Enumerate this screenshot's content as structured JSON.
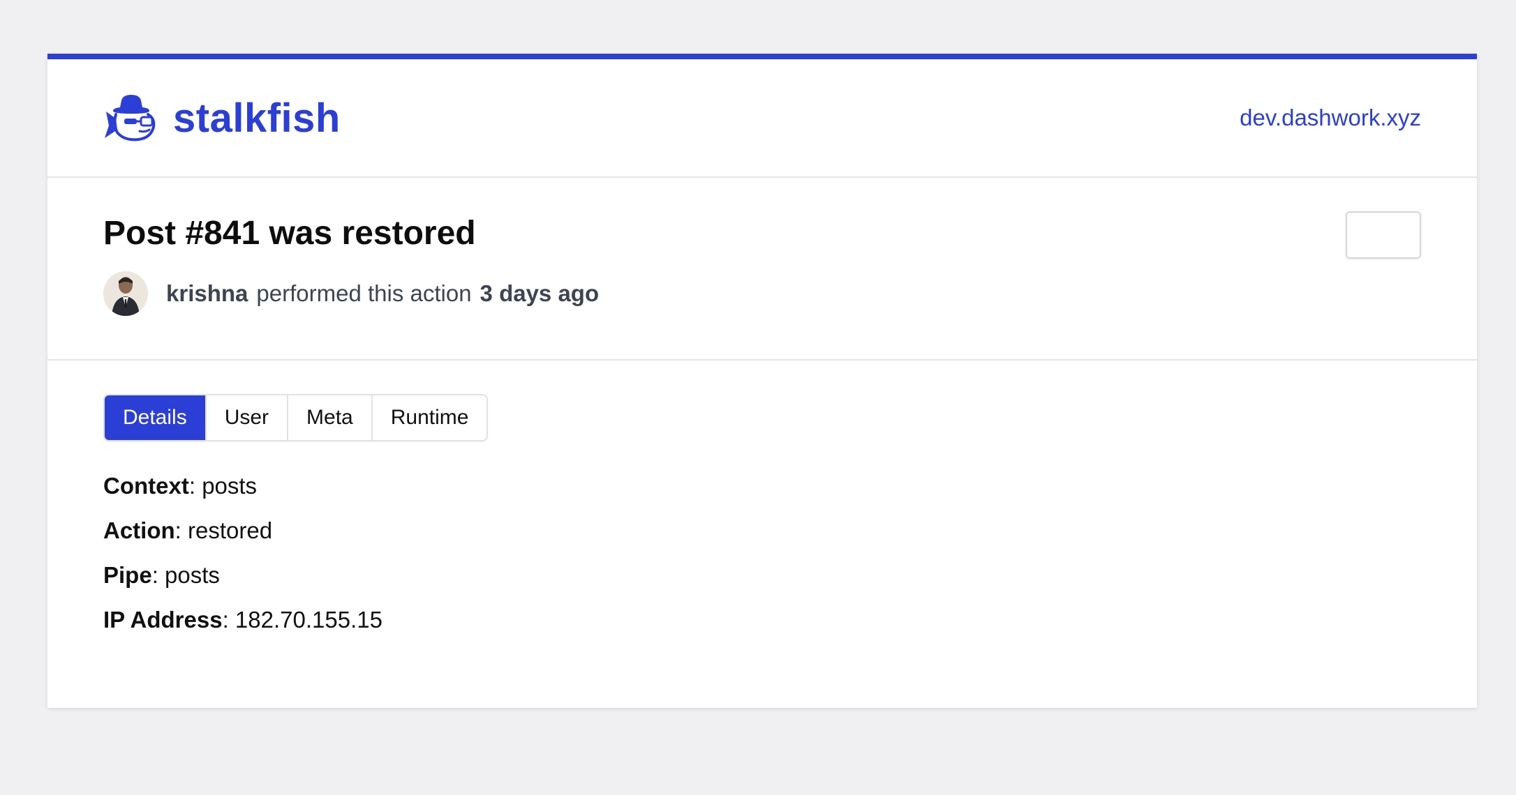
{
  "brand": {
    "name": "stalkfish",
    "accent_color": "#2b3fd6",
    "icon": "detective-fish-logo-icon"
  },
  "header": {
    "site_link": "dev.dashwork.xyz"
  },
  "event": {
    "title": "Post #841 was restored",
    "actor": "krishna",
    "action_text": "performed this action",
    "time_ago": "3 days ago"
  },
  "tabs": [
    {
      "label": "Details",
      "active": true
    },
    {
      "label": "User",
      "active": false
    },
    {
      "label": "Meta",
      "active": false
    },
    {
      "label": "Runtime",
      "active": false
    }
  ],
  "details": [
    {
      "label": "Context",
      "value": "posts"
    },
    {
      "label": "Action",
      "value": "restored"
    },
    {
      "label": "Pipe",
      "value": "posts"
    },
    {
      "label": "IP Address",
      "value": "182.70.155.15"
    }
  ]
}
